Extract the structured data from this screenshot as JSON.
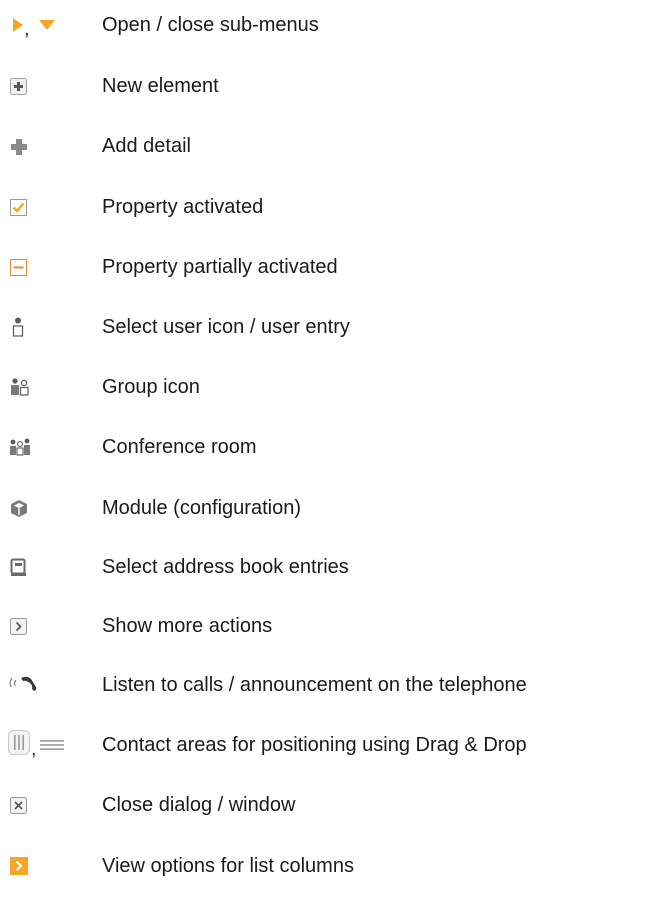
{
  "legend": {
    "items": [
      {
        "icon": [
          "expand-arrow-icon",
          "collapse-arrow-icon"
        ],
        "separator": ",",
        "label": "Open / close sub-menus"
      },
      {
        "icon": [
          "new-element-icon"
        ],
        "label": "New element"
      },
      {
        "icon": [
          "add-detail-icon"
        ],
        "label": "Add detail"
      },
      {
        "icon": [
          "checkbox-checked-icon"
        ],
        "label": "Property activated"
      },
      {
        "icon": [
          "checkbox-partial-icon"
        ],
        "label": "Property partially activated"
      },
      {
        "icon": [
          "user-icon"
        ],
        "label": "Select user icon / user entry"
      },
      {
        "icon": [
          "group-icon"
        ],
        "label": "Group icon"
      },
      {
        "icon": [
          "conference-room-icon"
        ],
        "label": "Conference room"
      },
      {
        "icon": [
          "module-icon"
        ],
        "label": "Module (configuration)"
      },
      {
        "icon": [
          "address-book-icon"
        ],
        "label": "Select address book entries"
      },
      {
        "icon": [
          "more-actions-icon"
        ],
        "label": "Show more actions"
      },
      {
        "icon": [
          "listen-phone-icon"
        ],
        "label": "Listen to calls / announcement on the telephone"
      },
      {
        "icon": [
          "vertical-drag-handle-icon",
          "horizontal-drag-handle-icon"
        ],
        "separator": ",",
        "label": "Contact areas for positioning using Drag & Drop"
      },
      {
        "icon": [
          "close-dialog-icon"
        ],
        "label": "Close dialog / window"
      },
      {
        "icon": [
          "view-options-icon"
        ],
        "label": "View options for list columns"
      }
    ]
  },
  "colors": {
    "accent_orange": "#f5a623",
    "icon_gray": "#8a8a8a",
    "text": "#1a1a1a"
  }
}
